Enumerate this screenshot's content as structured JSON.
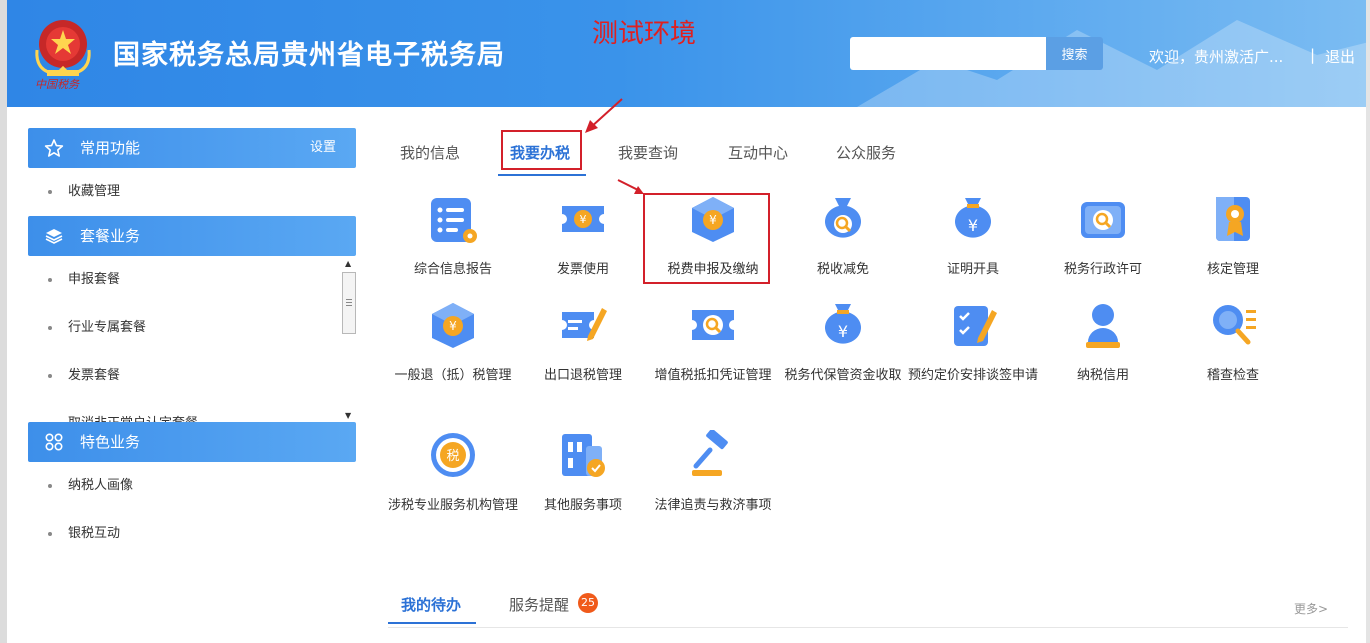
{
  "header": {
    "site_title": "国家税务总局贵州省电子税务局",
    "env_label": "测试环境",
    "emblem_caption": "中国税务",
    "search_placeholder": "",
    "search_button": "搜索",
    "welcome": "欢迎，贵州激活广...",
    "separator": "|",
    "logout": "退出"
  },
  "sidebar": {
    "common": {
      "title": "常用功能",
      "setting": "设置",
      "items": [
        "收藏管理"
      ]
    },
    "package": {
      "title": "套餐业务",
      "items": [
        "申报套餐",
        "行业专属套餐",
        "发票套餐",
        "取消非正常户认定套餐"
      ]
    },
    "special": {
      "title": "特色业务",
      "items": [
        "纳税人画像",
        "银税互动"
      ]
    }
  },
  "tabs": [
    "我的信息",
    "我要办税",
    "我要查询",
    "互动中心",
    "公众服务"
  ],
  "active_tab": "我要办税",
  "tiles": [
    {
      "label": "综合信息报告",
      "icon": "report-icon"
    },
    {
      "label": "发票使用",
      "icon": "invoice-icon"
    },
    {
      "label": "税费申报及缴纳",
      "icon": "tax-declaration-icon"
    },
    {
      "label": "税收减免",
      "icon": "tax-relief-icon"
    },
    {
      "label": "证明开具",
      "icon": "certificate-icon"
    },
    {
      "label": "税务行政许可",
      "icon": "admin-license-icon"
    },
    {
      "label": "核定管理",
      "icon": "verification-icon"
    },
    {
      "label": "一般退（抵）税管理",
      "icon": "tax-refund-icon"
    },
    {
      "label": "出口退税管理",
      "icon": "export-refund-icon"
    },
    {
      "label": "增值税抵扣凭证管理",
      "icon": "vat-deduction-icon"
    },
    {
      "label": "税务代保管资金收取",
      "icon": "custody-fund-icon"
    },
    {
      "label": "预约定价安排谈签申请",
      "icon": "pricing-arrangement-icon"
    },
    {
      "label": "纳税信用",
      "icon": "tax-credit-icon"
    },
    {
      "label": "稽查检查",
      "icon": "inspection-icon"
    },
    {
      "label": "涉税专业服务机构管理",
      "icon": "service-agency-icon"
    },
    {
      "label": "其他服务事项",
      "icon": "other-services-icon"
    },
    {
      "label": "法律追责与救济事项",
      "icon": "legal-relief-icon"
    }
  ],
  "bottom": {
    "todo": "我的待办",
    "reminders": "服务提醒",
    "reminder_count": "25",
    "more": "更多>"
  },
  "colors": {
    "brand_blue": "#2f86e6",
    "accent_blue": "#2c72d6",
    "highlight_red": "#d3202a",
    "badge_orange": "#f05a1a"
  }
}
